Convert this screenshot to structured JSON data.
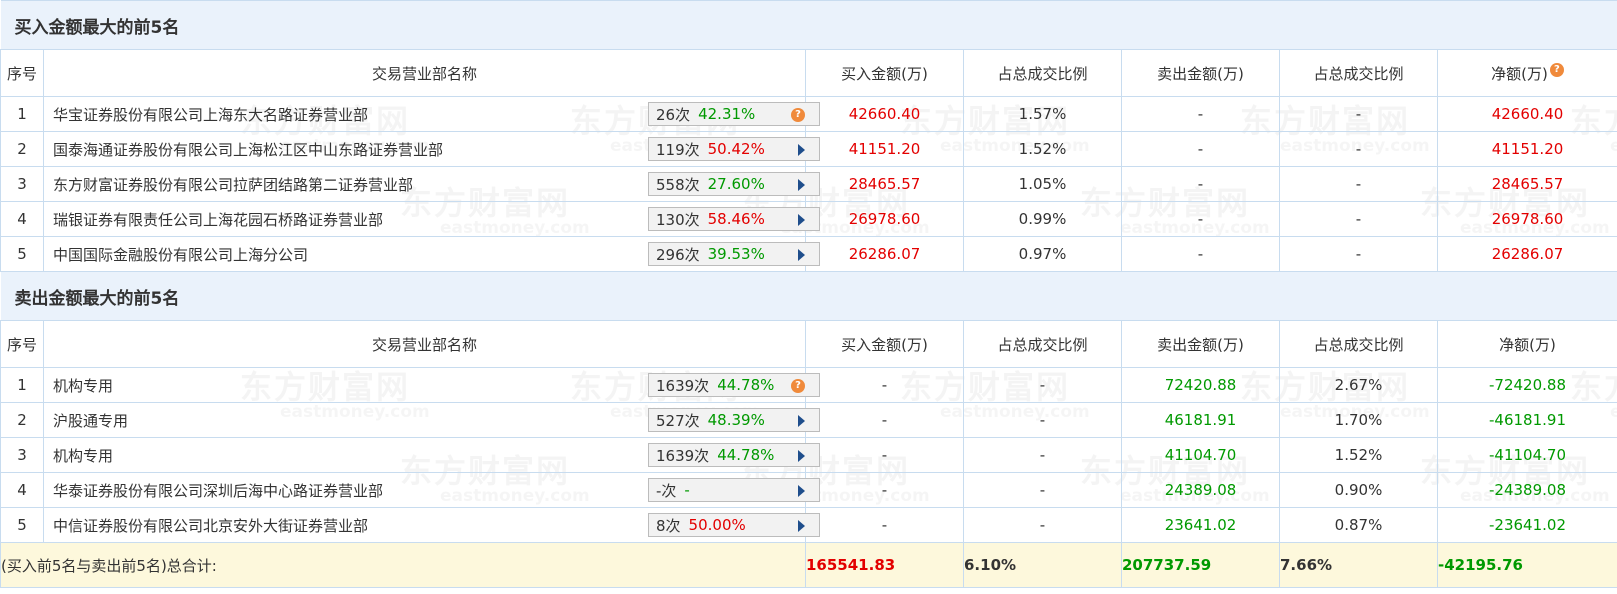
{
  "buy_section": {
    "title": "买入金额最大的前5名",
    "headers": [
      "序号",
      "交易营业部名称",
      "买入金额(万)",
      "占总成交比例",
      "卖出金额(万)",
      "占总成交比例",
      "净额(万)"
    ],
    "rows": [
      {
        "idx": "1",
        "name": "华宝证券股份有限公司上海东大名路证券营业部",
        "count": "26次",
        "rate": "42.31%",
        "icon": "question-icon",
        "buy": "42660.40",
        "buy_pct": "1.57%",
        "sell": "-",
        "sell_pct": "-",
        "net": "42660.40"
      },
      {
        "idx": "2",
        "name": "国泰海通证券股份有限公司上海松江区中山东路证券营业部",
        "count": "119次",
        "rate": "50.42%",
        "icon": "arrow-right-icon",
        "buy": "41151.20",
        "buy_pct": "1.52%",
        "sell": "-",
        "sell_pct": "-",
        "net": "41151.20"
      },
      {
        "idx": "3",
        "name": "东方财富证券股份有限公司拉萨团结路第二证券营业部",
        "count": "558次",
        "rate": "27.60%",
        "icon": "arrow-right-icon",
        "buy": "28465.57",
        "buy_pct": "1.05%",
        "sell": "-",
        "sell_pct": "-",
        "net": "28465.57"
      },
      {
        "idx": "4",
        "name": "瑞银证券有限责任公司上海花园石桥路证券营业部",
        "count": "130次",
        "rate": "58.46%",
        "icon": "arrow-right-icon",
        "buy": "26978.60",
        "buy_pct": "0.99%",
        "sell": "-",
        "sell_pct": "-",
        "net": "26978.60"
      },
      {
        "idx": "5",
        "name": "中国国际金融股份有限公司上海分公司",
        "count": "296次",
        "rate": "39.53%",
        "icon": "arrow-right-icon",
        "buy": "26286.07",
        "buy_pct": "0.97%",
        "sell": "-",
        "sell_pct": "-",
        "net": "26286.07"
      }
    ]
  },
  "sell_section": {
    "title": "卖出金额最大的前5名",
    "headers": [
      "序号",
      "交易营业部名称",
      "买入金额(万)",
      "占总成交比例",
      "卖出金额(万)",
      "占总成交比例",
      "净额(万)"
    ],
    "rows": [
      {
        "idx": "1",
        "name": "机构专用",
        "count": "1639次",
        "rate": "44.78%",
        "icon": "question-icon",
        "buy": "-",
        "buy_pct": "-",
        "sell": "72420.88",
        "sell_pct": "2.67%",
        "net": "-72420.88"
      },
      {
        "idx": "2",
        "name": "沪股通专用",
        "count": "527次",
        "rate": "48.39%",
        "icon": "arrow-right-icon",
        "buy": "-",
        "buy_pct": "-",
        "sell": "46181.91",
        "sell_pct": "1.70%",
        "net": "-46181.91"
      },
      {
        "idx": "3",
        "name": "机构专用",
        "count": "1639次",
        "rate": "44.78%",
        "icon": "arrow-right-icon",
        "buy": "-",
        "buy_pct": "-",
        "sell": "41104.70",
        "sell_pct": "1.52%",
        "net": "-41104.70"
      },
      {
        "idx": "4",
        "name": "华泰证券股份有限公司深圳后海中心路证券营业部",
        "count": "-次",
        "rate": "-",
        "icon": "arrow-right-icon",
        "buy": "-",
        "buy_pct": "-",
        "sell": "24389.08",
        "sell_pct": "0.90%",
        "net": "-24389.08"
      },
      {
        "idx": "5",
        "name": "中信证券股份有限公司北京安外大街证券营业部",
        "count": "8次",
        "rate": "50.00%",
        "icon": "arrow-right-icon",
        "buy": "-",
        "buy_pct": "-",
        "sell": "23641.02",
        "sell_pct": "0.87%",
        "net": "-23641.02"
      }
    ]
  },
  "total": {
    "label": "(买入前5名与卖出前5名)总合计:",
    "buy": "165541.83",
    "buy_pct": "6.10%",
    "sell": "207737.59",
    "sell_pct": "7.66%",
    "net": "-42195.76"
  },
  "watermark": {
    "cn": "东方财富网",
    "en": "eastmoney.com"
  },
  "colors": {
    "up": "#e30000",
    "down": "#009900",
    "section_bg": "#eaf2fb",
    "total_bg": "#fdf8dc",
    "border": "#c8dcef",
    "help_icon": "#f08a3b",
    "arrow": "#1f4e8c"
  }
}
